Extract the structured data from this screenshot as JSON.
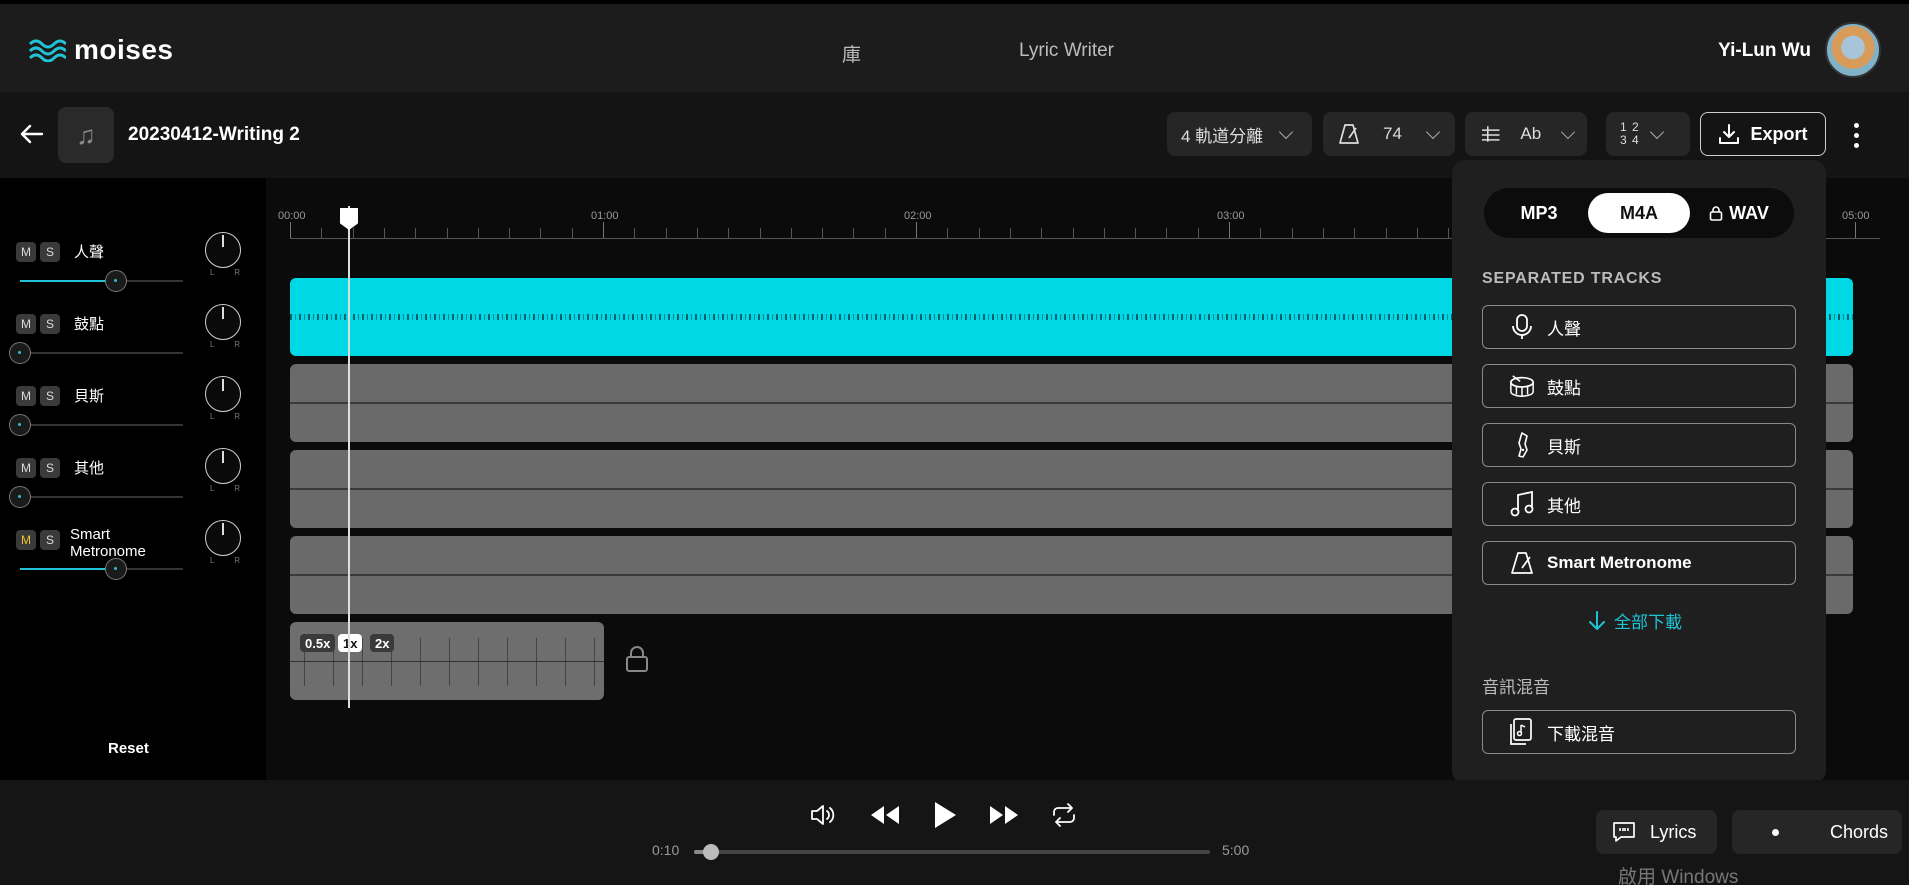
{
  "header": {
    "logo_text": "moises",
    "nav": [
      "庫",
      "Lyric Writer"
    ],
    "user_name": "Yi-Lun Wu"
  },
  "toolbar": {
    "song_title": "20230412-Writing 2",
    "separation": "4 軌道分離",
    "bpm": "74",
    "key": "Ab",
    "time_signature_top": "1 2",
    "time_signature_bottom": "3 4",
    "export_label": "Export"
  },
  "mixer": {
    "mute_label": "M",
    "solo_label": "S",
    "pan_left": "L",
    "pan_right": "R",
    "tracks": [
      {
        "name": "人聲",
        "volume": 0.59,
        "mute_active": false
      },
      {
        "name": "鼓點",
        "volume": 0.0,
        "mute_active": false
      },
      {
        "name": "貝斯",
        "volume": 0.0,
        "mute_active": false
      },
      {
        "name": "其他",
        "volume": 0.0,
        "mute_active": false
      },
      {
        "name": "Smart Metronome",
        "volume": 0.59,
        "mute_active": true
      }
    ],
    "reset_label": "Reset"
  },
  "timeline": {
    "ticks": [
      "00:00",
      "01:00",
      "02:00",
      "03:00",
      "05:00"
    ],
    "speed_options": [
      "0.5x",
      "1x",
      "2x"
    ],
    "speed_selected": "1x"
  },
  "export_popup": {
    "formats": [
      "MP3",
      "M4A",
      "WAV"
    ],
    "selected_format": "M4A",
    "locked_format": "WAV",
    "separated_heading": "SEPARATED TRACKS",
    "tracks": [
      {
        "label": "人聲",
        "icon": "microphone-icon"
      },
      {
        "label": "鼓點",
        "icon": "drum-icon"
      },
      {
        "label": "貝斯",
        "icon": "bass-guitar-icon"
      },
      {
        "label": "其他",
        "icon": "music-note-icon"
      },
      {
        "label": "Smart Metronome",
        "icon": "metronome-icon"
      }
    ],
    "download_all": "全部下載",
    "mix_heading": "音訊混音",
    "download_mix": "下載混音"
  },
  "player": {
    "current_time": "0:10",
    "total_time": "5:00",
    "progress": 0.033
  },
  "bottom_buttons": {
    "lyrics": "Lyrics",
    "chords": "Chords"
  },
  "os_watermark": "啟用 Windows",
  "colors": {
    "accent": "#00d8e6",
    "link": "#1fc3d6",
    "mute_active": "#f2c12e"
  }
}
